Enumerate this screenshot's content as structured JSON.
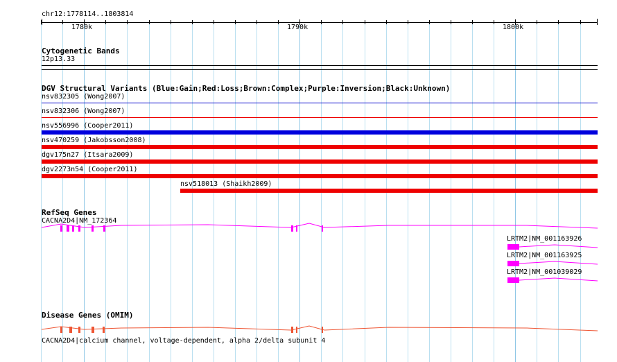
{
  "ruler": {
    "region": "chr12:1778114..1803814",
    "ticks": [
      "1780k",
      "1790k",
      "1800k"
    ]
  },
  "tracks": {
    "cytoband": {
      "title": "Cytogenetic Bands",
      "band": "12p13.33"
    },
    "dgv": {
      "title": "DGV Structural Variants (Blue:Gain;Red:Loss;Brown:Complex;Purple:Inversion;Black:Unknown)",
      "features": [
        {
          "label": "nsv832305 (Wong2007)",
          "color": "#0000cc"
        },
        {
          "label": "nsv832306 (Wong2007)",
          "color": "#ee0000"
        },
        {
          "label": "nsv556996 (Cooper2011)",
          "color": "#0000dd"
        },
        {
          "label": "nsv470259 (Jakobsson2008)",
          "color": "#ee0000"
        },
        {
          "label": "dgv175n27 (Itsara2009)",
          "color": "#ee0000"
        },
        {
          "label": "dgv2273n54 (Cooper2011)",
          "color": "#ee0000"
        },
        {
          "label": "nsv518013 (Shaikh2009)",
          "color": "#ee0000"
        }
      ]
    },
    "refseq": {
      "title": "RefSeq Genes",
      "color": "#ff00ff",
      "genes": [
        {
          "label": "CACNA2D4|NM_172364"
        },
        {
          "label": "LRTM2|NM_001163926"
        },
        {
          "label": "LRTM2|NM_001163925"
        },
        {
          "label": "LRTM2|NM_001039029"
        }
      ]
    },
    "omim": {
      "title": "Disease Genes (OMIM)",
      "color": "#ee5533",
      "label": "CACNA2D4|calcium channel, voltage-dependent, alpha 2/delta subunit 4"
    }
  }
}
